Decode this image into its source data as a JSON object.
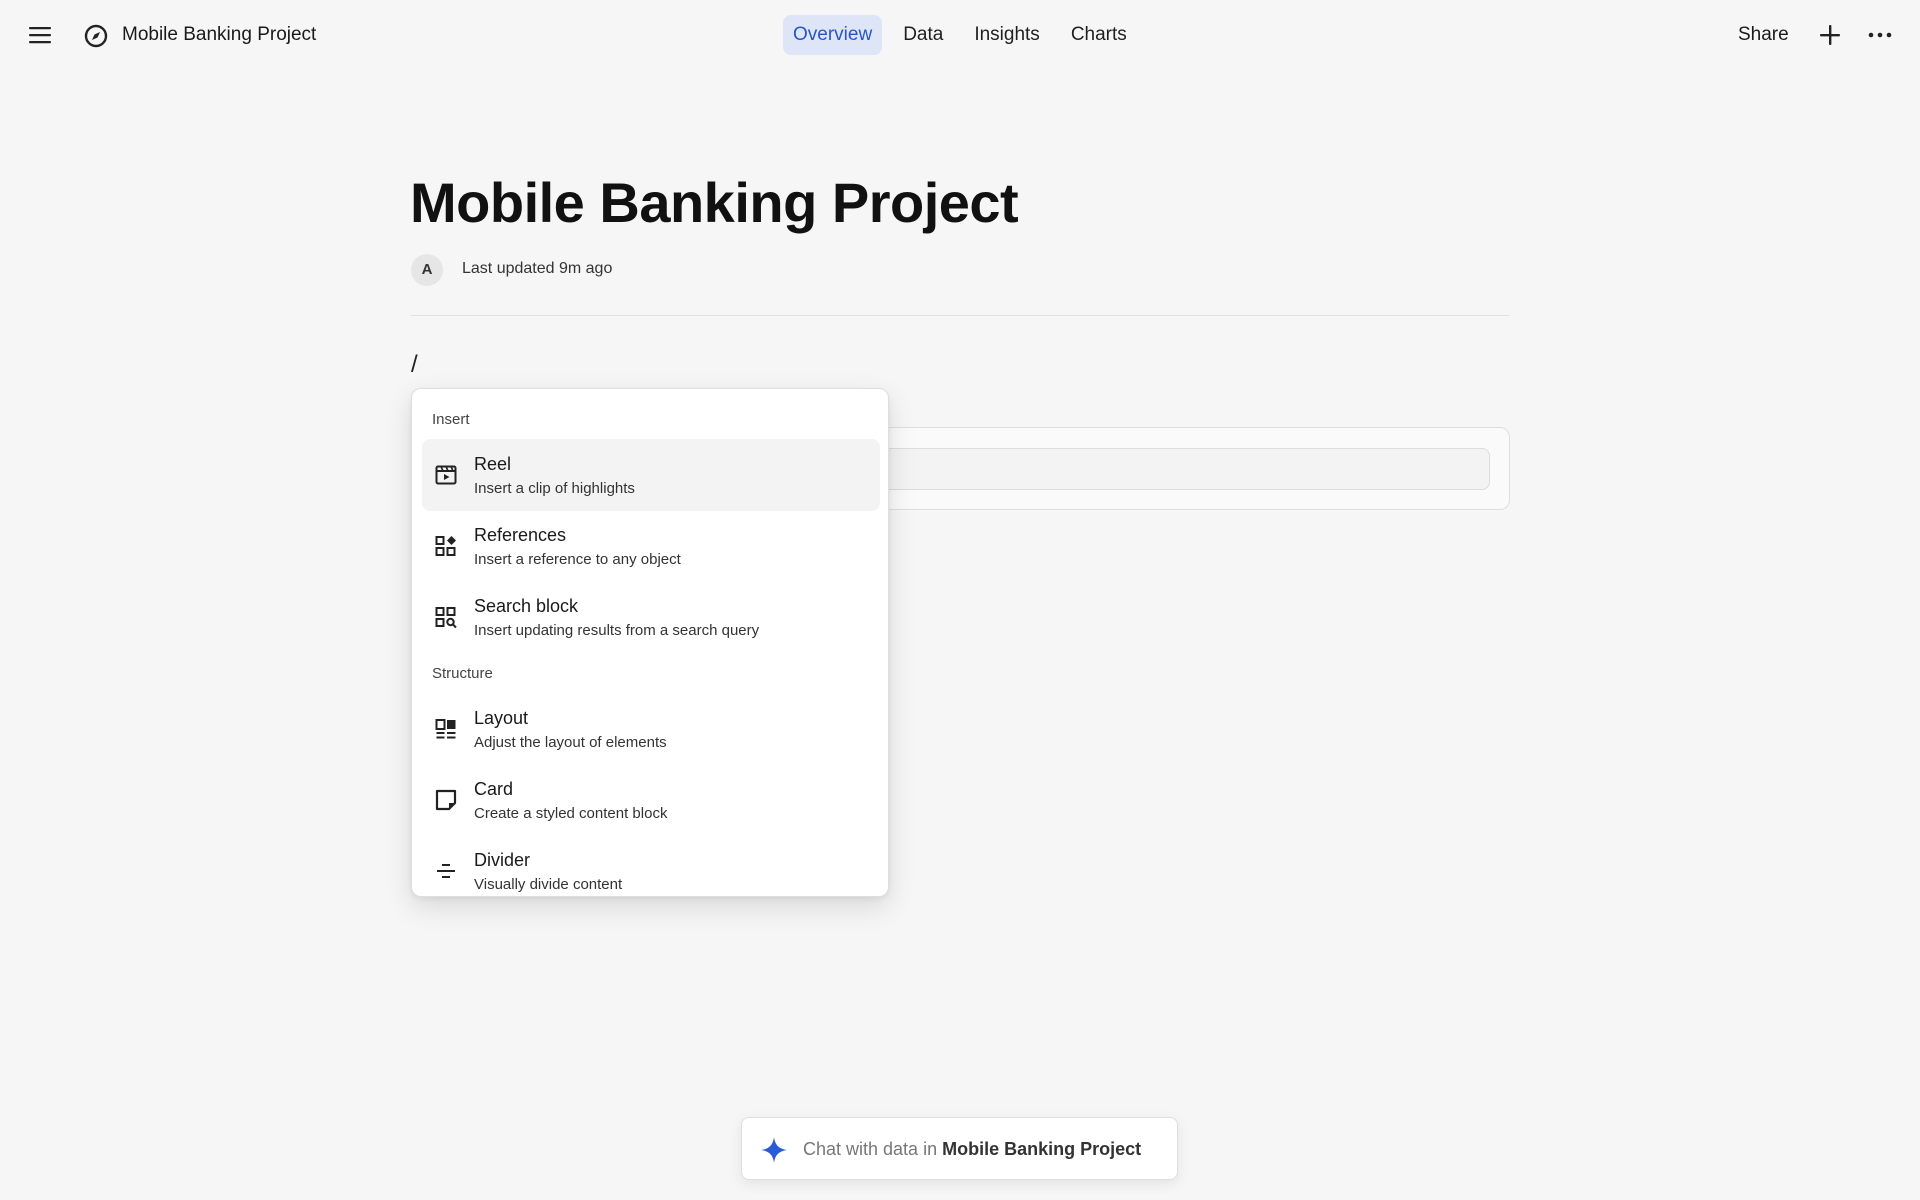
{
  "header": {
    "menu_icon": "hamburger-menu-icon",
    "project_icon": "compass-icon",
    "project_name": "Mobile Banking Project",
    "tabs": [
      {
        "label": "Overview",
        "active": true
      },
      {
        "label": "Data",
        "active": false
      },
      {
        "label": "Insights",
        "active": false
      },
      {
        "label": "Charts",
        "active": false
      }
    ],
    "share_label": "Share",
    "plus_icon": "plus-icon",
    "more_icon": "more-horizontal-icon"
  },
  "document": {
    "title": "Mobile Banking Project",
    "avatar_initial": "A",
    "last_updated": "Last updated 9m ago",
    "editor_text": "/"
  },
  "slash_menu": {
    "sections": [
      {
        "label": "Insert",
        "items": [
          {
            "icon": "reel-icon",
            "title": "Reel",
            "description": "Insert a clip of highlights",
            "highlighted": true
          },
          {
            "icon": "references-icon",
            "title": "References",
            "description": "Insert a reference to any object",
            "highlighted": false
          },
          {
            "icon": "search-block-icon",
            "title": "Search block",
            "description": "Insert updating results from a search query",
            "highlighted": false
          }
        ]
      },
      {
        "label": "Structure",
        "items": [
          {
            "icon": "layout-icon",
            "title": "Layout",
            "description": "Adjust the layout of elements",
            "highlighted": false
          },
          {
            "icon": "card-icon",
            "title": "Card",
            "description": "Create a styled content block",
            "highlighted": false
          },
          {
            "icon": "divider-icon",
            "title": "Divider",
            "description": "Visually divide content",
            "highlighted": false
          }
        ]
      }
    ]
  },
  "chat": {
    "icon": "sparkle-icon",
    "prefix": "Chat with data in",
    "project": "Mobile Banking Project"
  },
  "colors": {
    "background": "#f6f6f6",
    "active_tab_bg": "#dde5f6",
    "active_tab_text": "#2756c9",
    "sparkle": "#2a5bd7"
  }
}
